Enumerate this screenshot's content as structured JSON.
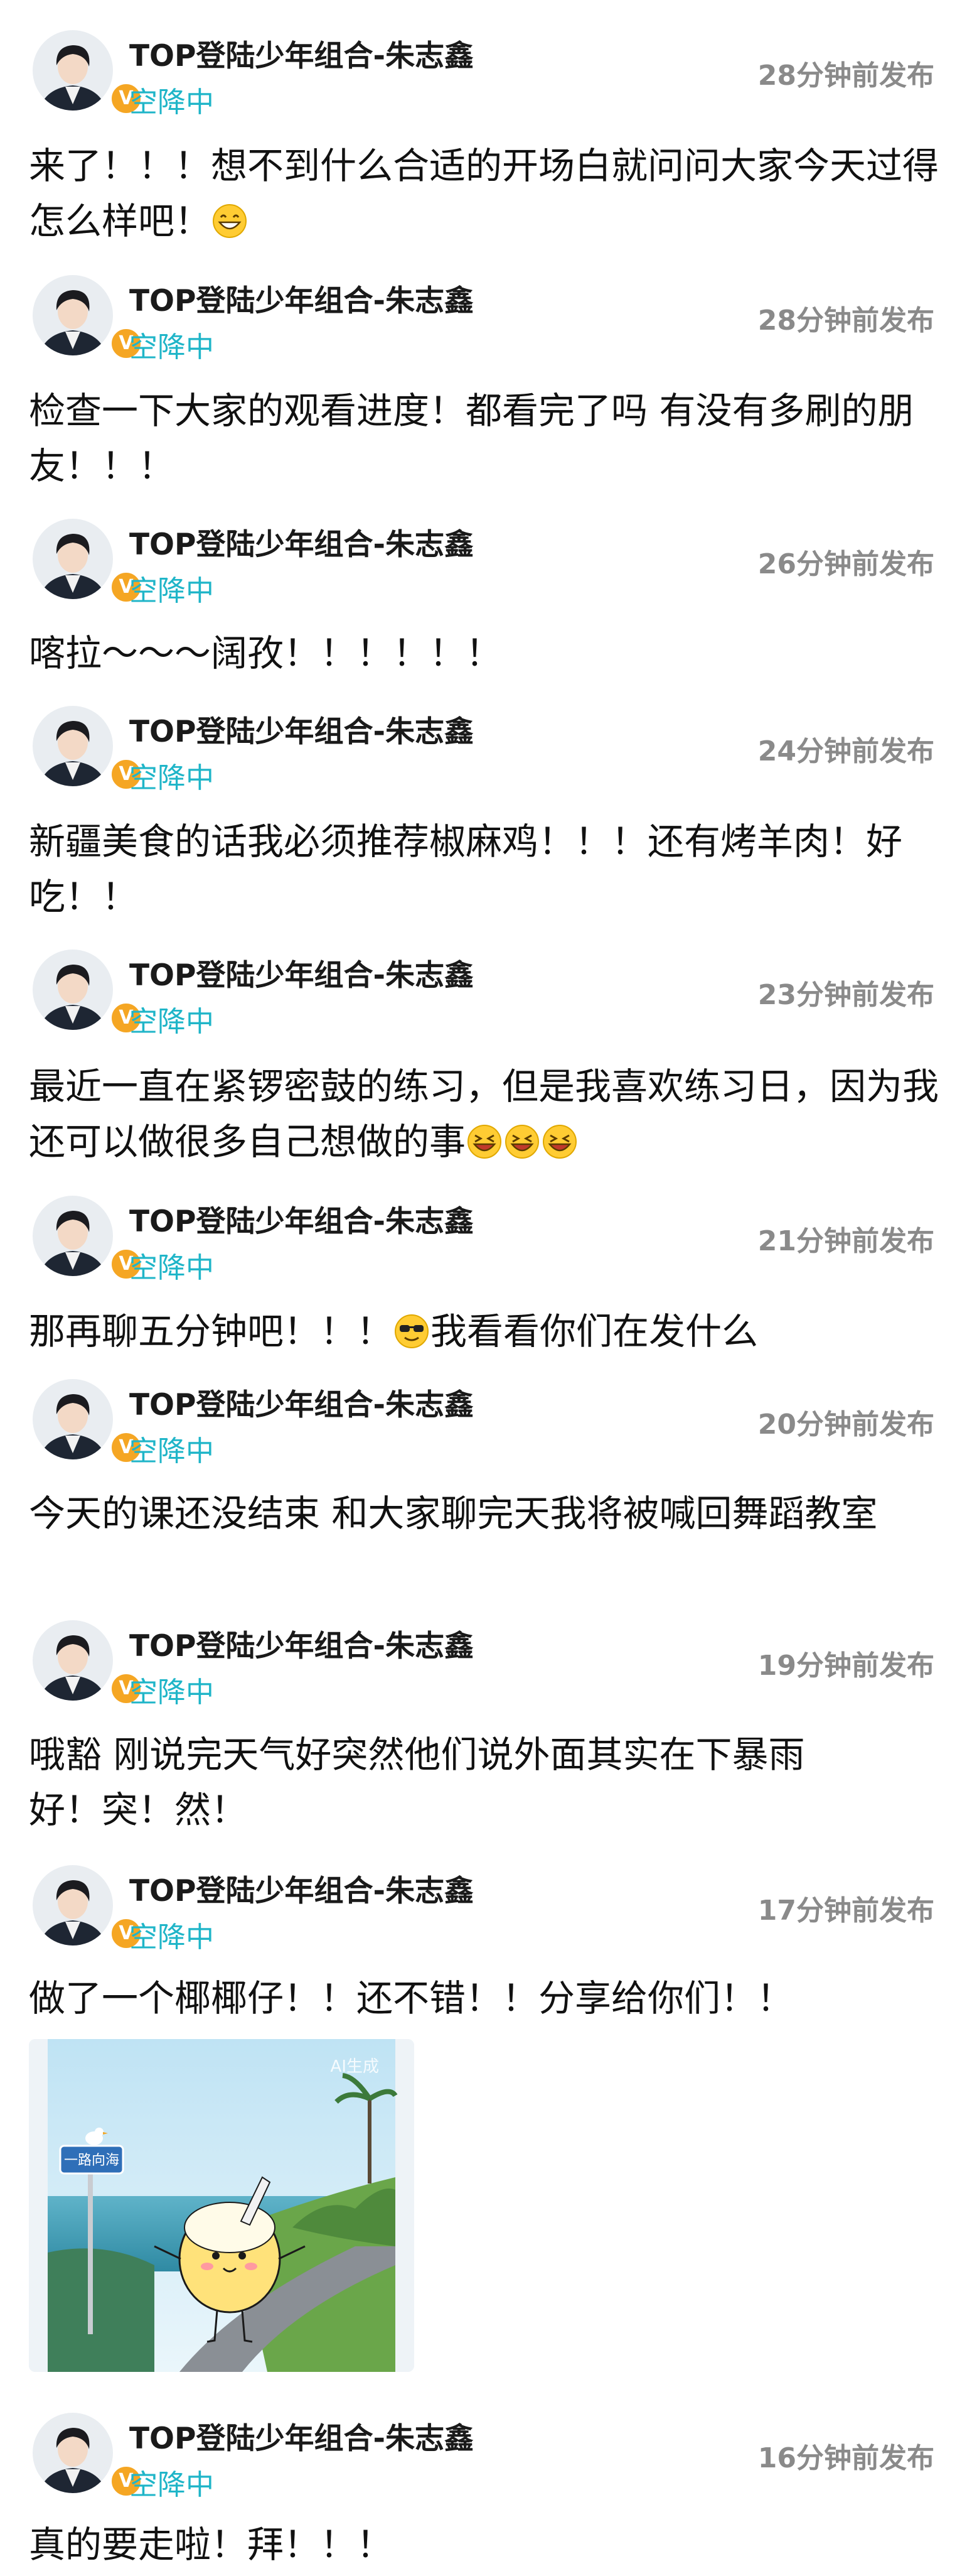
{
  "author": {
    "name": "TOP登陆少年组合-朱志鑫",
    "status": "空降中",
    "verified_badge": "V",
    "verified_color": "#f5a623",
    "status_color": "#1fb5c8"
  },
  "posts": [
    {
      "time": "28分钟前发布",
      "text": "来了！！！想不到什么合适的开场白就问问大家今天过得怎么样吧！",
      "emoji": [
        "grin-emoji"
      ]
    },
    {
      "time": "28分钟前发布",
      "text": "检查一下大家的观看进度！都看完了吗 有没有多刷的朋友！！！"
    },
    {
      "time": "26分钟前发布",
      "text": "喀拉～～～阔孜！！！！！！"
    },
    {
      "time": "24分钟前发布",
      "text": "新疆美食的话我必须推荐椒麻鸡！！！还有烤羊肉！好吃！！"
    },
    {
      "time": "23分钟前发布",
      "text": "最近一直在紧锣密鼓的练习，但是我喜欢练习日，因为我还可以做很多自己想做的事",
      "emoji": [
        "laughing-emoji",
        "laughing-emoji",
        "laughing-emoji"
      ]
    },
    {
      "time": "21分钟前发布",
      "text_before": "那再聊五分钟吧！！！",
      "text_after": "我看看你们在发什么",
      "emoji": [
        "sunglasses-emoji"
      ]
    },
    {
      "time": "20分钟前发布",
      "text": "今天的课还没结束 和大家聊完天我将被喊回舞蹈教室"
    },
    {
      "time": "19分钟前发布",
      "text_line1": "哦豁 刚说完天气好突然他们说外面其实在下暴雨",
      "text_line2": "好！突！然！"
    },
    {
      "time": "17分钟前发布",
      "text": "做了一个椰椰仔！！还不错！！分享给你们！！",
      "image": {
        "watermark": "AI生成",
        "sign": "一路向海"
      }
    },
    {
      "time": "16分钟前发布",
      "text": "真的要走啦！拜！！！"
    }
  ]
}
